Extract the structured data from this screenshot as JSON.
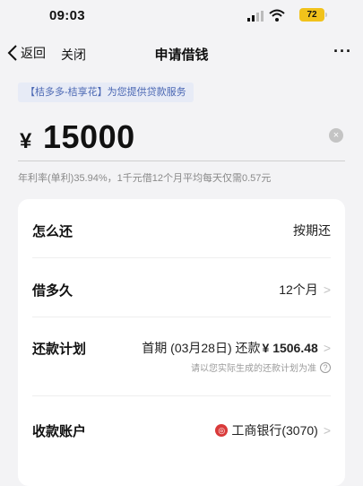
{
  "status_bar": {
    "time": "09:03",
    "battery": "72"
  },
  "nav": {
    "back_label": "返回",
    "close_label": "关闭",
    "title": "申请借钱",
    "more_label": "···"
  },
  "provider_tag": "【桔多多-桔享花】为您提供贷款服务",
  "amount": {
    "currency": "¥",
    "value": "15000"
  },
  "rate_text": "年利率(单利)35.94%，1千元借12个月平均每天仅需0.57元",
  "rows": {
    "repay_method": {
      "label": "怎么还",
      "value": "按期还"
    },
    "term": {
      "label": "借多久",
      "value": "12个月"
    },
    "plan": {
      "label": "还款计划",
      "value_prefix": "首期 (03月28日) 还款",
      "value_amount": "¥ 1506.48",
      "note": "请以您实际生成的还款计划为准"
    },
    "account": {
      "label": "收款账户",
      "value": "工商银行(3070)"
    }
  },
  "icons": {
    "back": "chevron-left-icon",
    "clear": "clear-icon",
    "help": "question-icon",
    "bank": "icbc-logo-icon"
  },
  "colors": {
    "provider_text": "#4a67b3",
    "bank_logo": "#d93a3a",
    "battery": "#f1c21b"
  }
}
